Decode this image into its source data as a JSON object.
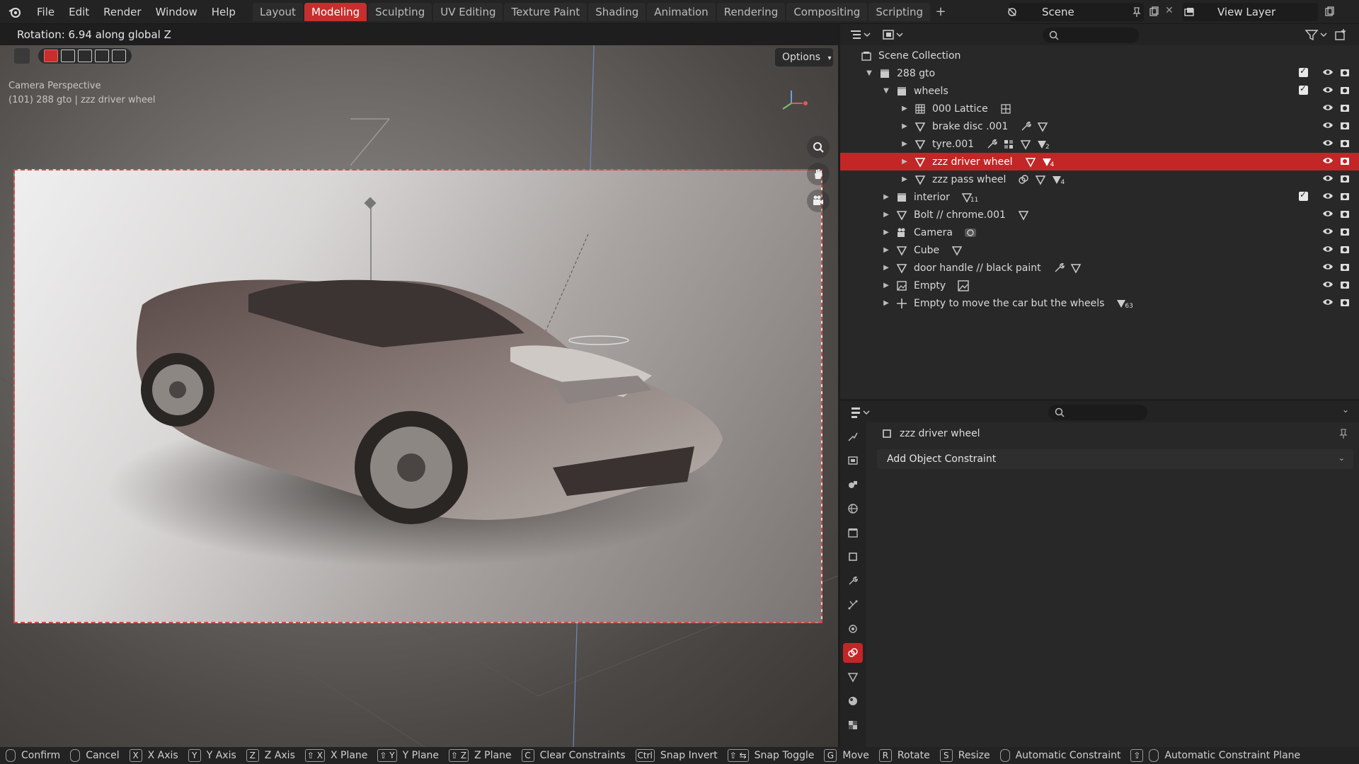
{
  "topbar": {
    "menu": [
      "File",
      "Edit",
      "Render",
      "Window",
      "Help"
    ],
    "workspaces": [
      "Layout",
      "Modeling",
      "Sculpting",
      "UV Editing",
      "Texture Paint",
      "Shading",
      "Animation",
      "Rendering",
      "Compositing",
      "Scripting"
    ],
    "active_workspace": "Modeling",
    "add_workspace": "+",
    "scene": "Scene",
    "view_layer": "View Layer"
  },
  "viewport": {
    "status": "Rotation: 6.94 along global Z",
    "options": "Options",
    "overlay_line1": "Camera Perspective",
    "overlay_line2": "(101) 288 gto | zzz driver wheel"
  },
  "outliner": {
    "rows": [
      {
        "label": "Scene Collection",
        "level": 0,
        "icon": "scene-collection-icon"
      },
      {
        "label": "288 gto",
        "level": 1,
        "icon": "collection-icon",
        "expanded": true
      },
      {
        "label": "wheels",
        "level": 2,
        "icon": "collection-icon",
        "expanded": true
      },
      {
        "label": "000 Lattice",
        "level": 3,
        "icon": "lattice-icon"
      },
      {
        "label": "brake disc .001",
        "level": 3,
        "icon": "mesh-icon"
      },
      {
        "label": "tyre.001",
        "level": 3,
        "icon": "mesh-icon"
      },
      {
        "label": "zzz driver wheel",
        "level": 3,
        "icon": "mesh-icon",
        "selected": true
      },
      {
        "label": "zzz pass wheel",
        "level": 3,
        "icon": "mesh-icon"
      },
      {
        "label": "interior",
        "level": 2,
        "icon": "collection-icon"
      },
      {
        "label": "Bolt // chrome.001",
        "level": 2,
        "icon": "mesh-icon"
      },
      {
        "label": "Camera",
        "level": 2,
        "icon": "camera-icon"
      },
      {
        "label": "Cube",
        "level": 2,
        "icon": "mesh-icon"
      },
      {
        "label": "door handle // black paint",
        "level": 2,
        "icon": "mesh-icon"
      },
      {
        "label": "Empty",
        "level": 2,
        "icon": "image-empty-icon"
      },
      {
        "label": "Empty to move the car but the wheels",
        "level": 2,
        "icon": "empty-icon"
      }
    ],
    "subscripts": {
      "tyre": "2",
      "driver": "4",
      "pass": "4",
      "interior": "11",
      "empty_move": "63"
    }
  },
  "properties": {
    "object_name": "zzz driver wheel",
    "add_constraint": "Add Object Constraint"
  },
  "statusbar": {
    "items": [
      {
        "key": "",
        "label": "Confirm",
        "mouse": true
      },
      {
        "key": "",
        "label": "Cancel",
        "mouse": true
      },
      {
        "key": "X",
        "label": "X Axis"
      },
      {
        "key": "Y",
        "label": "Y Axis"
      },
      {
        "key": "Z",
        "label": "Z Axis"
      },
      {
        "key": "⇧ X",
        "label": "X Plane"
      },
      {
        "key": "⇧ Y",
        "label": "Y Plane"
      },
      {
        "key": "⇧ Z",
        "label": "Z Plane"
      },
      {
        "key": "C",
        "label": "Clear Constraints"
      },
      {
        "key": "Ctrl",
        "label": "Snap Invert"
      },
      {
        "key": "⇧ ⇆",
        "label": "Snap Toggle"
      },
      {
        "key": "G",
        "label": "Move"
      },
      {
        "key": "R",
        "label": "Rotate"
      },
      {
        "key": "S",
        "label": "Resize"
      },
      {
        "key": "",
        "label": "Automatic Constraint",
        "mouse": true
      },
      {
        "key": "⇧",
        "label": "Automatic Constraint Plane",
        "mouse": true
      }
    ]
  }
}
